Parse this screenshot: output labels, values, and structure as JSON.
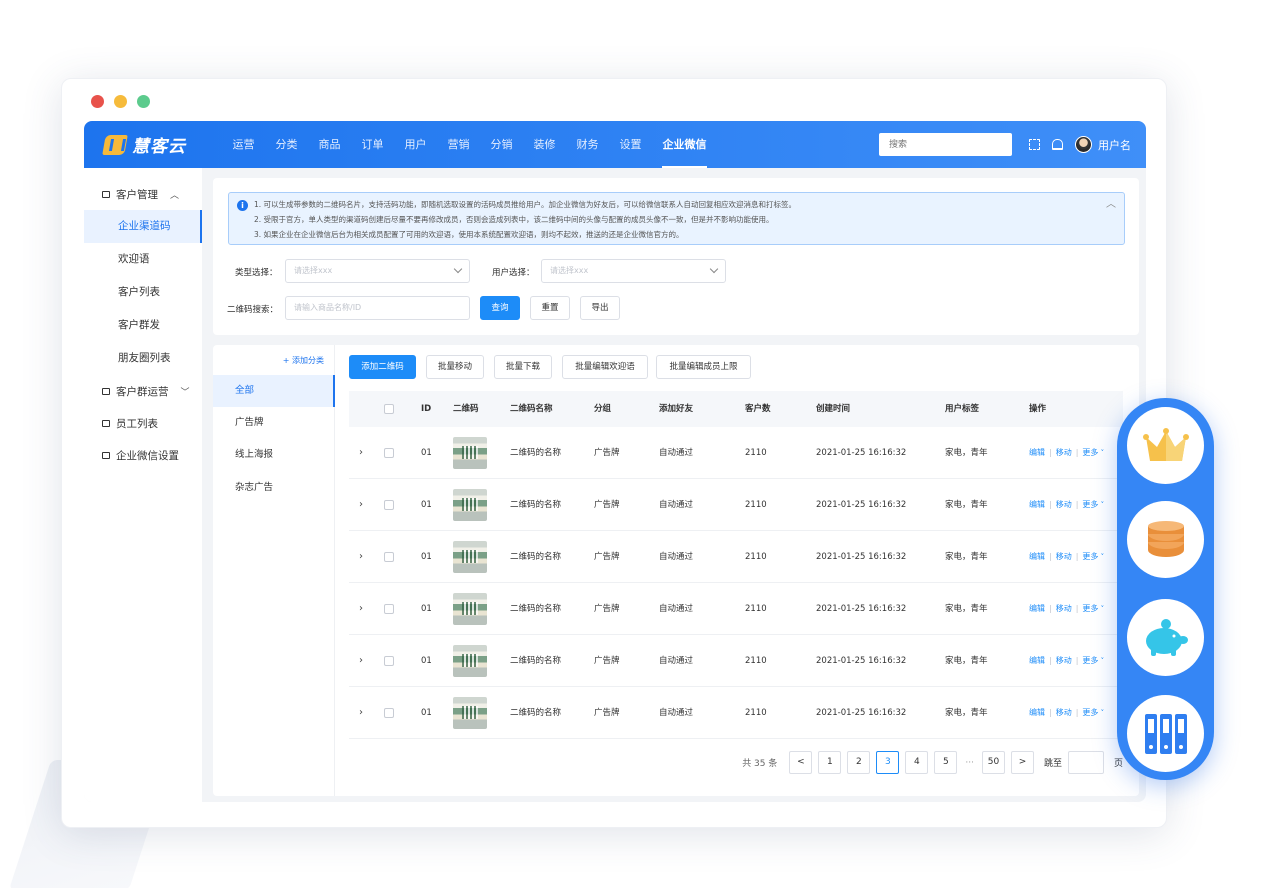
{
  "brand": {
    "name": "慧客云"
  },
  "topnav": {
    "items": [
      "运营",
      "分类",
      "商品",
      "订单",
      "用户",
      "营销",
      "分销",
      "装修",
      "财务",
      "设置",
      "企业微信"
    ],
    "active_index": 10,
    "search_placeholder": "搜索",
    "username": "用户名"
  },
  "sidebar": {
    "groups": [
      {
        "label": "客户管理",
        "items": [
          "企业渠道码",
          "欢迎语",
          "客户列表",
          "客户群发",
          "朋友圈列表"
        ]
      },
      {
        "label": "客户群运营"
      },
      {
        "label": "员工列表"
      },
      {
        "label": "企业微信设置"
      }
    ],
    "active_item": "企业渠道码"
  },
  "notice": {
    "lines": [
      "1. 可以生成带参数的二维码名片，支持活码功能，即随机选取设置的活码成员推给用户。加企业微信为好友后，可以给微信联系人自动回复相应欢迎消息和打标签。",
      "2. 受限于官方，单人类型的渠道码创建后尽量不要再修改成员，否则会造成列表中，该二维码中间的头像与配置的成员头像不一致，但是并不影响功能使用。",
      "3. 如果企业在企业微信后台为相关成员配置了可用的欢迎语，使用本系统配置欢迎语，则均不起效，推送的还是企业微信官方的。"
    ]
  },
  "filters": {
    "type_label": "类型选择：",
    "type_placeholder": "请选择xxx",
    "user_label": "用户选择：",
    "user_placeholder": "请选择xxx",
    "search_label": "二维码搜索：",
    "search_placeholder": "请输入商品名称/ID",
    "query_button": "查询",
    "reset_button": "重置",
    "export_button": "导出"
  },
  "categories": {
    "add_label": "+ 添加分类",
    "items": [
      "全部",
      "广告牌",
      "线上海报",
      "杂志广告"
    ],
    "active_index": 0
  },
  "toolbar": {
    "buttons": [
      "添加二维码",
      "批量移动",
      "批量下载",
      "批量编辑欢迎语",
      "批量编辑成员上限"
    ]
  },
  "table": {
    "columns": [
      "ID",
      "二维码",
      "二维码名称",
      "分组",
      "添加好友",
      "客户数",
      "创建时间",
      "用户标签",
      "操作"
    ],
    "rows": [
      {
        "id": "01",
        "name": "二维码的名称",
        "group": "广告牌",
        "add_friend": "自动通过",
        "customers": "2110",
        "created": "2021-01-25 16:16:32",
        "tags": "家电，青年"
      },
      {
        "id": "01",
        "name": "二维码的名称",
        "group": "广告牌",
        "add_friend": "自动通过",
        "customers": "2110",
        "created": "2021-01-25 16:16:32",
        "tags": "家电，青年"
      },
      {
        "id": "01",
        "name": "二维码的名称",
        "group": "广告牌",
        "add_friend": "自动通过",
        "customers": "2110",
        "created": "2021-01-25 16:16:32",
        "tags": "家电，青年"
      },
      {
        "id": "01",
        "name": "二维码的名称",
        "group": "广告牌",
        "add_friend": "自动通过",
        "customers": "2110",
        "created": "2021-01-25 16:16:32",
        "tags": "家电，青年"
      },
      {
        "id": "01",
        "name": "二维码的名称",
        "group": "广告牌",
        "add_friend": "自动通过",
        "customers": "2110",
        "created": "2021-01-25 16:16:32",
        "tags": "家电，青年"
      },
      {
        "id": "01",
        "name": "二维码的名称",
        "group": "广告牌",
        "add_friend": "自动通过",
        "customers": "2110",
        "created": "2021-01-25 16:16:32",
        "tags": "家电，青年"
      }
    ],
    "ops": {
      "edit": "编辑",
      "move": "移动",
      "more": "更多"
    }
  },
  "pager": {
    "total": "共 35 条",
    "pages": [
      "1",
      "2",
      "3",
      "4",
      "5",
      "50"
    ],
    "current": "3",
    "ellipsis": "···",
    "jump_label": "跳至",
    "page_suffix": "页"
  },
  "float_icons": [
    "crown-icon",
    "coins-icon",
    "piggy-bank-icon",
    "server-icon"
  ],
  "colors": {
    "primary": "#1d8cf8",
    "nav": "#1d74ee",
    "accent_gold": "#f6b93b",
    "accent_orange": "#e98f3a",
    "float_bar": "#3586f5"
  }
}
